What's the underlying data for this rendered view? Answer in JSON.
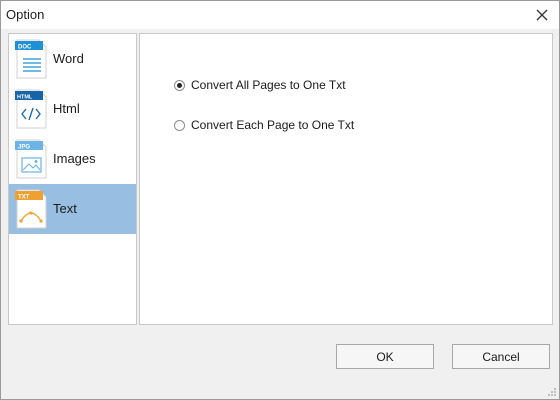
{
  "window": {
    "title": "Option",
    "close_icon": "close-icon"
  },
  "sidebar": {
    "items": [
      {
        "label": "Word",
        "badge": "DOC",
        "icon": "word-doc-icon",
        "color": "#1e90d6",
        "selected": false
      },
      {
        "label": "Html",
        "badge": "HTML",
        "icon": "html-doc-icon",
        "color": "#1565a8",
        "selected": false
      },
      {
        "label": "Images",
        "badge": "JPG",
        "icon": "image-doc-icon",
        "color": "#6ab4e8",
        "selected": false
      },
      {
        "label": "Text",
        "badge": "TXT",
        "icon": "text-doc-icon",
        "color": "#f0a030",
        "selected": true
      }
    ]
  },
  "options": {
    "convert_all": {
      "label": "Convert All Pages to One Txt",
      "checked": true
    },
    "convert_each": {
      "label": "Convert Each Page to One Txt",
      "checked": false
    }
  },
  "buttons": {
    "ok_label": "OK",
    "cancel_label": "Cancel"
  },
  "colors": {
    "selected_bg": "#98bfe1",
    "accent_blue": "#1e90d6",
    "txt_orange": "#f0a030"
  }
}
